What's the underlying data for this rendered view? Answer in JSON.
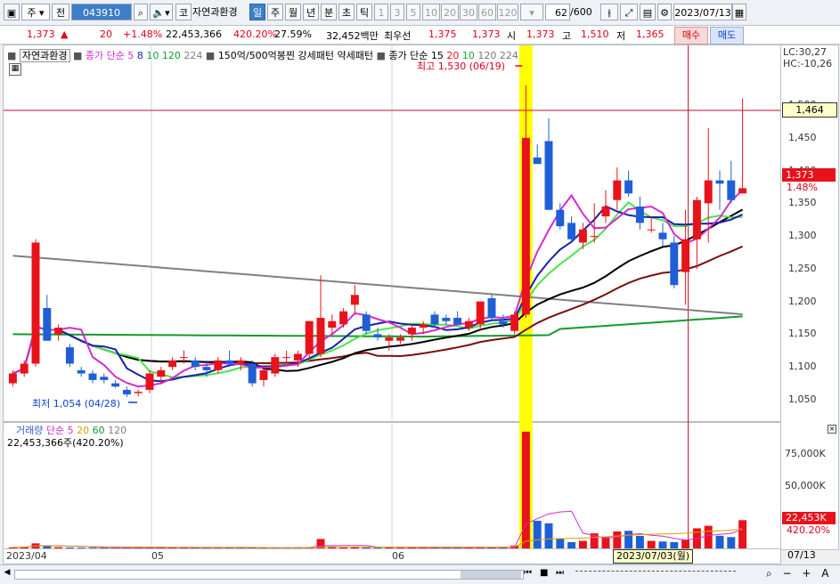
{
  "toolbar": {
    "market_type": "주",
    "prev_label": "전",
    "stock_code": "043910",
    "stock_name": "자연과환경",
    "code_prefix": "코",
    "periods": [
      "일",
      "주",
      "월",
      "년",
      "분",
      "초",
      "틱"
    ],
    "active_period": "일",
    "intervals": [
      "1",
      "3",
      "5",
      "10",
      "20",
      "30",
      "60",
      "120"
    ],
    "count_value": "62",
    "count_total": "/600",
    "date_value": "2023/07/13"
  },
  "quote": {
    "price": "1,373",
    "arrow": "▲",
    "change": "20",
    "change_pct": "+1.48%",
    "volume": "22,453,366",
    "volume_ratio": "420.20%",
    "turnover": "27.59%",
    "amount": "32,452백만",
    "best_ask_label": "최우선",
    "best_ask": "1,375",
    "best_bid": "1,373",
    "open_label": "시",
    "open": "1,373",
    "high_label": "고",
    "high": "1,510",
    "low_label": "저",
    "low": "1,365",
    "buy_label": "매수",
    "sell_label": "매도"
  },
  "price_legend": {
    "name": "자연과환경",
    "ma_label": "종가 단순",
    "ma_periods": [
      "5",
      "8",
      "10",
      "120",
      "224"
    ],
    "pattern_label": "150억/500억봉찐",
    "strong_label": "강세패턴",
    "weak_label": "약세패턴",
    "ma2_label": "종가 단순",
    "ma2_periods": [
      "15",
      "20",
      "10",
      "120",
      "224"
    ],
    "lc": "LC:30,27",
    "hc": "HC:-10,26"
  },
  "annotations": {
    "high": "최고 1,530 (06/19)",
    "low": "최저 1,054 (04/28)"
  },
  "price_axis": {
    "ticks": [
      "1,500",
      "1,450",
      "1,400",
      "1,350",
      "1,300",
      "1,250",
      "1,200",
      "1,150",
      "1,100",
      "1,050"
    ],
    "crosshair_value": "1,464",
    "current_value": "1,373",
    "current_pct": "1.48%"
  },
  "volume_legend": {
    "label": "거래량",
    "ma_label": "단순",
    "periods": [
      "5",
      "20",
      "60",
      "120"
    ],
    "value": "22,453,366주(420.20%)"
  },
  "volume_axis": {
    "ticks": [
      "75,000K",
      "50,000K",
      "25,000K"
    ],
    "current_value": "22,453K",
    "current_pct": "420.20%"
  },
  "x_axis": {
    "labels": [
      "2023/04",
      "05",
      "06",
      "07/13"
    ],
    "crosshair_date": "2023/07/03(월)"
  },
  "colors": {
    "up": "#e8121b",
    "down": "#1f5fd6",
    "highlight": "#ffff00",
    "ma5": "#d42bd0",
    "ma10": "#1a1fa8",
    "ma20": "#4ce34c",
    "ma60": "#000000",
    "ma120": "#808080",
    "ma224": "#119b2b",
    "ma_long": "#7a0f0f"
  },
  "chart_data": {
    "type": "candlestick",
    "ylim": [
      1020,
      1530
    ],
    "candles": [
      [
        1075,
        1095,
        1070,
        1090
      ],
      [
        1090,
        1110,
        1085,
        1105
      ],
      [
        1105,
        1295,
        1100,
        1290
      ],
      [
        1190,
        1210,
        1140,
        1140
      ],
      [
        1150,
        1165,
        1140,
        1160
      ],
      [
        1130,
        1135,
        1100,
        1105
      ],
      [
        1095,
        1100,
        1085,
        1090
      ],
      [
        1090,
        1095,
        1075,
        1080
      ],
      [
        1085,
        1090,
        1075,
        1080
      ],
      [
        1075,
        1080,
        1068,
        1070
      ],
      [
        1065,
        1070,
        1054,
        1058
      ],
      [
        1060,
        1065,
        1055,
        1062
      ],
      [
        1065,
        1095,
        1060,
        1090
      ],
      [
        1085,
        1100,
        1075,
        1095
      ],
      [
        1100,
        1115,
        1095,
        1110
      ],
      [
        1115,
        1125,
        1105,
        1115
      ],
      [
        1110,
        1115,
        1095,
        1100
      ],
      [
        1100,
        1110,
        1085,
        1095
      ],
      [
        1095,
        1115,
        1090,
        1110
      ],
      [
        1110,
        1125,
        1100,
        1105
      ],
      [
        1105,
        1115,
        1095,
        1110
      ],
      [
        1105,
        1110,
        1070,
        1075
      ],
      [
        1080,
        1100,
        1070,
        1095
      ],
      [
        1090,
        1120,
        1085,
        1115
      ],
      [
        1115,
        1125,
        1105,
        1115
      ],
      [
        1110,
        1125,
        1100,
        1120
      ],
      [
        1120,
        1170,
        1110,
        1170
      ],
      [
        1120,
        1240,
        1115,
        1175
      ],
      [
        1160,
        1180,
        1150,
        1170
      ],
      [
        1165,
        1190,
        1160,
        1185
      ],
      [
        1195,
        1225,
        1180,
        1210
      ],
      [
        1180,
        1185,
        1150,
        1155
      ],
      [
        1150,
        1160,
        1140,
        1145
      ],
      [
        1140,
        1150,
        1125,
        1145
      ],
      [
        1140,
        1150,
        1135,
        1145
      ],
      [
        1150,
        1165,
        1140,
        1160
      ],
      [
        1160,
        1170,
        1150,
        1165
      ],
      [
        1180,
        1185,
        1160,
        1165
      ],
      [
        1175,
        1180,
        1165,
        1170
      ],
      [
        1175,
        1185,
        1165,
        1165
      ],
      [
        1160,
        1175,
        1155,
        1170
      ],
      [
        1165,
        1200,
        1155,
        1200
      ],
      [
        1205,
        1210,
        1170,
        1175
      ],
      [
        1170,
        1180,
        1160,
        1165
      ],
      [
        1155,
        1185,
        1150,
        1180
      ],
      [
        1180,
        1530,
        1175,
        1450
      ],
      [
        1420,
        1440,
        1410,
        1410
      ],
      [
        1445,
        1480,
        1340,
        1340
      ],
      [
        1340,
        1350,
        1310,
        1315
      ],
      [
        1320,
        1330,
        1290,
        1295
      ],
      [
        1290,
        1320,
        1280,
        1310
      ],
      [
        1300,
        1350,
        1290,
        1300
      ],
      [
        1330,
        1370,
        1320,
        1345
      ],
      [
        1355,
        1405,
        1340,
        1385
      ],
      [
        1385,
        1400,
        1360,
        1365
      ],
      [
        1345,
        1360,
        1310,
        1320
      ],
      [
        1310,
        1330,
        1305,
        1310
      ],
      [
        1305,
        1320,
        1285,
        1295
      ],
      [
        1290,
        1300,
        1220,
        1225
      ],
      [
        1245,
        1340,
        1195,
        1295
      ],
      [
        1295,
        1360,
        1250,
        1355
      ],
      [
        1350,
        1465,
        1290,
        1385
      ],
      [
        1385,
        1400,
        1340,
        1380
      ],
      [
        1385,
        1415,
        1350,
        1355
      ],
      [
        1365,
        1510,
        1365,
        1373
      ]
    ],
    "volume_ylim": [
      0,
      100000
    ],
    "volumes": [
      800,
      1200,
      4000,
      2500,
      900,
      700,
      600,
      500,
      450,
      400,
      600,
      800,
      500,
      600,
      700,
      650,
      500,
      550,
      500,
      520,
      480,
      600,
      550,
      600,
      620,
      700,
      650,
      7500,
      1500,
      900,
      1200,
      700,
      600,
      650,
      550,
      700,
      500,
      600,
      550,
      650,
      500,
      900,
      600,
      550,
      2200,
      93000,
      22000,
      20000,
      8000,
      5000,
      6000,
      12000,
      9000,
      13500,
      14000,
      10000,
      6000,
      5500,
      5000,
      7000,
      16000,
      18000,
      10000,
      9000,
      22453
    ]
  }
}
